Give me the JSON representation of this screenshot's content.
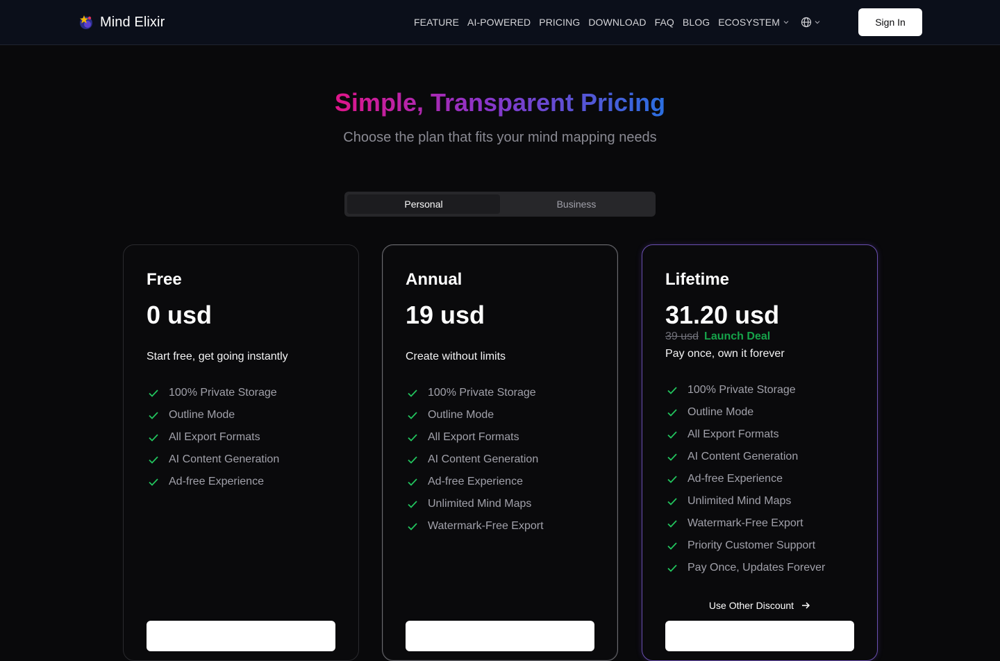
{
  "brand": {
    "name": "Mind Elixir"
  },
  "nav": {
    "links": [
      "FEATURE",
      "AI-POWERED",
      "PRICING",
      "DOWNLOAD",
      "FAQ",
      "BLOG",
      "ECOSYSTEM"
    ],
    "signin_label": "Sign In"
  },
  "hero": {
    "title": "Simple, Transparent Pricing",
    "subtitle": "Choose the plan that fits your mind mapping needs"
  },
  "toggle": {
    "tabs": [
      "Personal",
      "Business"
    ],
    "active": "Personal"
  },
  "plans": [
    {
      "name": "Free",
      "price": "0 usd",
      "description": "Start free, get going instantly",
      "features": [
        "100% Private Storage",
        "Outline Mode",
        "All Export Formats",
        "AI Content Generation",
        "Ad-free Experience"
      ]
    },
    {
      "name": "Annual",
      "price": "19 usd",
      "description": "Create without limits",
      "features": [
        "100% Private Storage",
        "Outline Mode",
        "All Export Formats",
        "AI Content Generation",
        "Ad-free Experience",
        "Unlimited Mind Maps",
        "Watermark-Free Export"
      ]
    },
    {
      "name": "Lifetime",
      "price": "31.20 usd",
      "original_price": "39 usd",
      "deal_label": "Launch Deal",
      "description": "Pay once, own it forever",
      "features": [
        "100% Private Storage",
        "Outline Mode",
        "All Export Formats",
        "AI Content Generation",
        "Ad-free Experience",
        "Unlimited Mind Maps",
        "Watermark-Free Export",
        "Priority Customer Support",
        "Pay Once, Updates Forever"
      ],
      "discount_link": "Use Other Discount"
    }
  ],
  "colors": {
    "check": "#22c55e",
    "deal": "#16a34a",
    "background": "#09090b"
  }
}
